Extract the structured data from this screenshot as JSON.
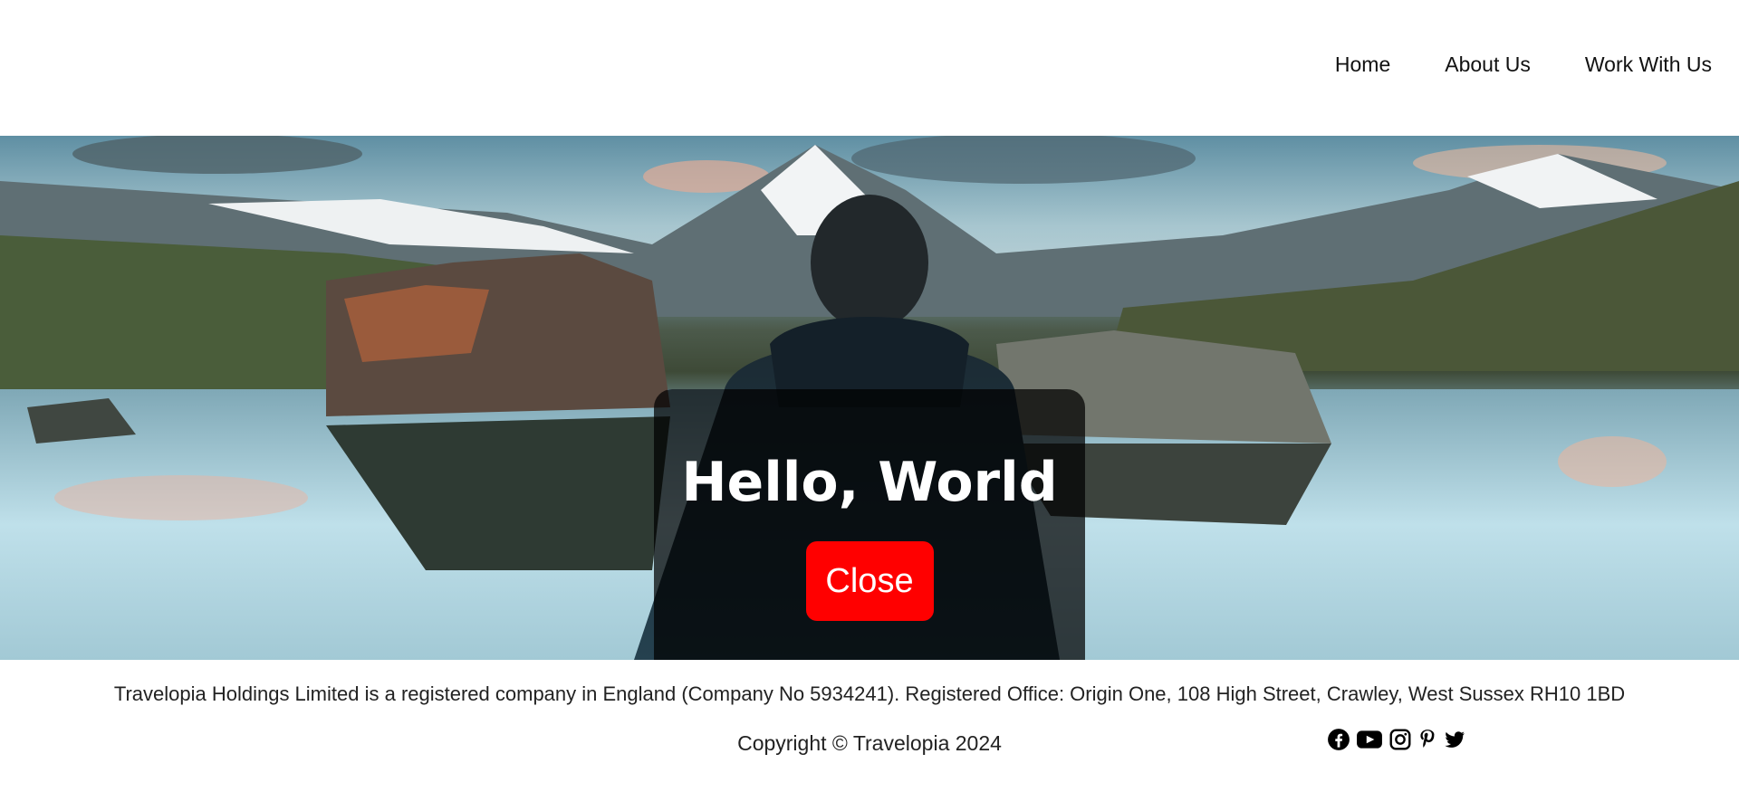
{
  "nav": {
    "items": [
      {
        "label": "Home"
      },
      {
        "label": "About Us"
      },
      {
        "label": "Work With Us"
      }
    ]
  },
  "modal": {
    "title": "Hello, World",
    "close_label": "Close"
  },
  "footer": {
    "legal": "Travelopia Holdings Limited is a registered company in England (Company No 5934241). Registered Office: Origin One, 108 High Street, Crawley, West Sussex RH10 1BD",
    "copyright": "Copyright © Travelopia 2024",
    "social_icons": [
      "facebook-icon",
      "youtube-icon",
      "instagram-icon",
      "pinterest-icon",
      "twitter-icon"
    ]
  },
  "colors": {
    "close_button": "#ff0000",
    "modal_overlay": "rgba(0,0,0,0.72)"
  }
}
